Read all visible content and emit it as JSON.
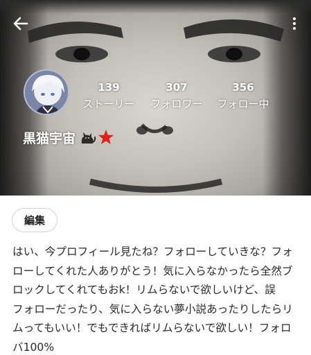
{
  "header": {
    "back_icon": "arrow-left-icon",
    "menu_icon": "more-vertical-icon"
  },
  "profile": {
    "username": "黒猫宇宙",
    "username_emoji": [
      "black-cat-emoji",
      "red-star-emoji"
    ],
    "stats": [
      {
        "value": "139",
        "label": "ストーリー"
      },
      {
        "value": "307",
        "label": "フォロワー"
      },
      {
        "value": "356",
        "label": "フォロー中"
      }
    ],
    "edit_label": "編集",
    "bio_lines": [
      "はい、今プロフィール見たね？フォローしていきな？フォ",
      "ローしてくれた人ありがとう！気に入らなかったら全然ブ",
      "ロックしてくれてもおk！リムらないで欲しいけど、誤",
      "フォローだったり、気に入らない夢小説あったりしたらリ",
      "ムってもいい！でもできればリムらないで欲しい！フォロ",
      "バ100%"
    ]
  },
  "colors": {
    "text_primary": "#2b2b2b",
    "header_overlay_text": "#ffffff",
    "accent_star": "#e0201a"
  }
}
